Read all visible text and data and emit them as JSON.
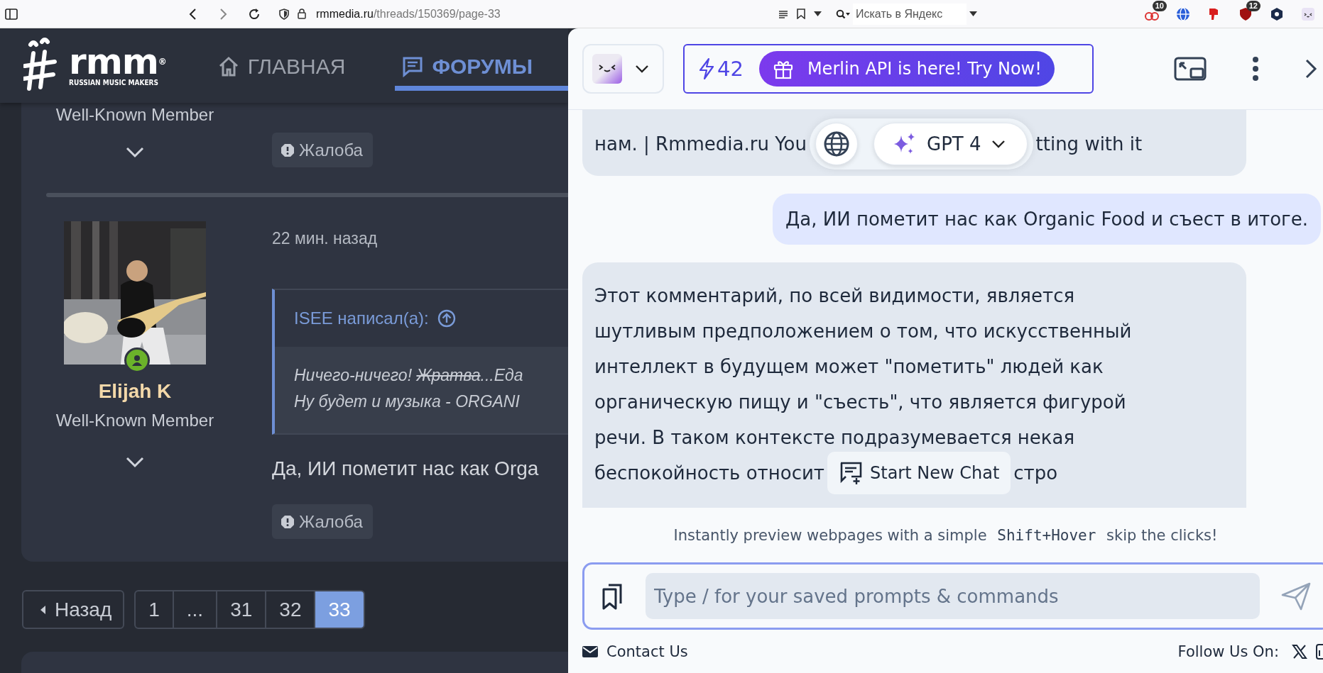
{
  "browser": {
    "url_domain": "rmmedia.ru",
    "url_path": "/threads/150369/page-33",
    "search_placeholder": "Искать в Яндекс",
    "extensions": [
      {
        "kind": "rings",
        "badge": "10"
      },
      {
        "kind": "globe"
      },
      {
        "kind": "thumb"
      },
      {
        "kind": "shield",
        "badge": "12"
      },
      {
        "kind": "hex"
      },
      {
        "kind": "face"
      }
    ]
  },
  "forum": {
    "logo": {
      "mark": "rmm",
      "registered": "®",
      "tagline": "RUSSIAN MUSIC MAKERS"
    },
    "nav": [
      {
        "kind": "home",
        "label": "ГЛАВНАЯ",
        "selected": false
      },
      {
        "kind": "forums",
        "label": "ФОРУМЫ",
        "selected": true
      }
    ],
    "prev_post": {
      "user_title": "Well-Known Member",
      "report": "Жалоба"
    },
    "post": {
      "author": "Elijah K",
      "user_title": "Well-Known Member",
      "online": true,
      "time": "22 мин. назад",
      "quote": {
        "title": "ISEE написал(а):",
        "lines": [
          [
            {
              "text": "Ничего-ничего! ",
              "struck": false
            },
            {
              "text": "Жратва",
              "struck": true
            },
            {
              "text": "...Еда",
              "struck": false
            }
          ],
          [
            {
              "text": "Ну будет и музыка - ORGANI",
              "struck": false
            }
          ]
        ]
      },
      "text": "Да, ИИ пометит нас как Orga",
      "report": "Жалоба"
    },
    "pagination": {
      "prev": "Назад",
      "pages": [
        {
          "label": "1",
          "selected": false
        },
        {
          "label": "...",
          "selected": false
        },
        {
          "label": "31",
          "selected": false
        },
        {
          "label": "32",
          "selected": false
        },
        {
          "label": "33",
          "selected": true
        }
      ]
    }
  },
  "merlin": {
    "credits": "42",
    "promo": "Merlin API is here! Try Now!",
    "messages": [
      {
        "kind": "bot",
        "overlay": {
          "kind": "model_picker",
          "label": "GPT 4"
        },
        "tail_before": "нам. | Rmmedia.ru You",
        "tail_after": "tting with it"
      },
      {
        "kind": "user",
        "lines": [
          "Да, ИИ пометит нас как Organic Food и съест в итоге."
        ]
      },
      {
        "kind": "bot",
        "overlay": {
          "kind": "button",
          "label": "Start New Chat"
        },
        "lines": [
          "Этот комментарий, по всей видимости, является",
          "шутливым предположением о том, что искусственный",
          "интеллект в будущем может \"пометить\" людей как",
          "органическую пищу и \"съесть\", что является фигурой",
          "речи. В таком контексте подразумевается некая"
        ],
        "tail_before": "беспокойность относит",
        "tail_after": "стро"
      }
    ],
    "tip": {
      "before": "Instantly preview webpages with a simple ",
      "key": "Shift+Hover",
      "after": " skip the clicks!"
    },
    "input_placeholder": "Type / for your saved prompts & commands",
    "contact": "Contact Us",
    "follow": "Follow Us On:",
    "socials": [
      {
        "kind": "x"
      },
      {
        "kind": "linkedin"
      }
    ]
  }
}
